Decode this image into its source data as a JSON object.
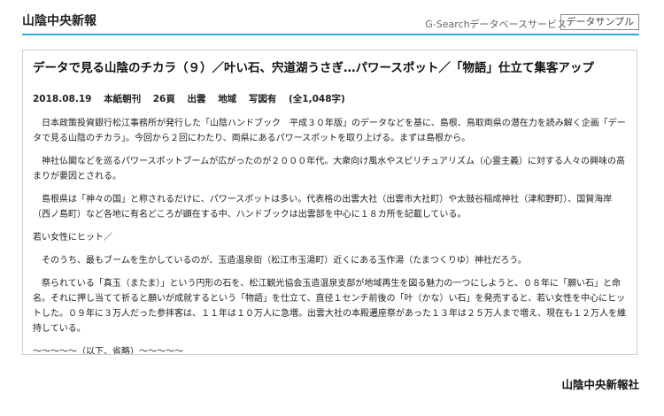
{
  "header": {
    "brand": "山陰中央新報",
    "service": "G-Searchデータベースサービス",
    "sample_badge": "データサンプル"
  },
  "article": {
    "headline": "データで見る山陰のチカラ（９）／叶い石、宍道湖うさぎ…パワースポット／「物語」仕立て集客アップ",
    "meta": {
      "date": "2018.08.19",
      "edition": "本紙朝刊",
      "page": "26頁",
      "region": "出雲",
      "section": "地域",
      "photo": "写図有",
      "chars": "(全1,048字)"
    },
    "paragraphs": [
      "　日本政策投資銀行松江事務所が発行した「山陰ハンドブック　平成３０年版」のデータなどを基に、島根、鳥取両県の潜在力を読み解く企画「データで見る山陰のチカラ」。今回から２回にわたり、両県にあるパワースポットを取り上げる。まずは島根から。",
      "　神社仏閣などを巡るパワースポットブームが広がったのが２０００年代。大衆向け風水やスピリチュアリズム（心霊主義）に対する人々の興味の高まりが要因とされる。",
      "　島根県は「神々の国」と称されるだけに、パワースポットは多い。代表格の出雲大社（出雲市大社町）や太鼓谷稲成神社（津和野町）、国賀海岸（西ノ島町）など各地に有名どころが顕在する中、ハンドブックは出雲部を中心に１８カ所を記載している。",
      "若い女性にヒット／",
      "　そのうち、最もブームを生かしているのが、玉造温泉街（松江市玉湯町）近くにある玉作湯（たまつくりゆ）神社だろう。",
      "　祭られている「真玉（またま）」という円形の石を、松江観光協会玉造温泉支部が地域再生を図る魅力の一つにしようと、０８年に「願い石」と命名。それに押し当てて祈ると願いが成就するという「物語」を仕立て、直径１センチ前後の「叶（かな）い石」を発売すると、若い女性を中心にヒットした。０９年に３万人だった参拝客は、１１年は１０万人に急増。出雲大社の本殿遷座祭があった１３年は２５万人まで増え、現在も１２万人を維持している。",
      "～～～～～（以下、省略）～～～～～"
    ]
  },
  "footer": {
    "brand": "山陰中央新報社"
  }
}
